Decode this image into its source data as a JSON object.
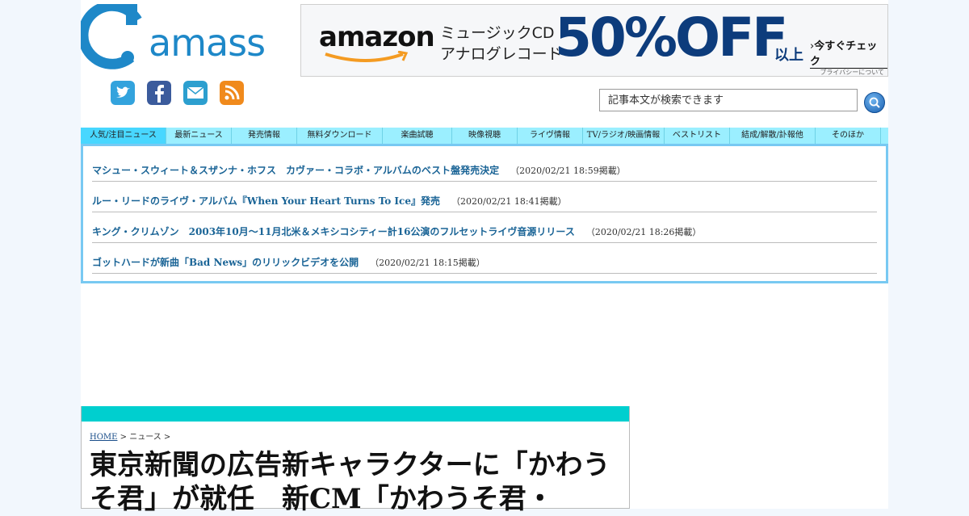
{
  "logo": {
    "text": "amass"
  },
  "social": [
    "twitter-icon",
    "facebook-icon",
    "mail-icon",
    "rss-icon"
  ],
  "ad": {
    "brand": "amazon",
    "line1": "ミュージックCD",
    "line2": "アナログレコード",
    "discount": "50%OFF",
    "suffix": "以上",
    "cta": "今すぐチェック",
    "privacy": "プライバシーについて"
  },
  "search": {
    "placeholder": "記事本文が検索できます"
  },
  "nav": [
    {
      "label": "人気/注目ニュース",
      "active": true
    },
    {
      "label": "最新ニュース"
    },
    {
      "label": "発売情報"
    },
    {
      "label": "無料ダウンロード"
    },
    {
      "label": "楽曲試聴"
    },
    {
      "label": "映像視聴"
    },
    {
      "label": "ライヴ情報"
    },
    {
      "label": "TV/ラジオ/映画情報"
    },
    {
      "label": "ベストリスト"
    },
    {
      "label": "結成/解散/訃報他"
    },
    {
      "label": "そのほか"
    }
  ],
  "news": [
    {
      "title": "マシュー・スウィート＆スザンナ・ホフス　カヴァー・コラボ・アルバムのベスト盤発売決定",
      "date": "（2020/02/21 18:59掲載）"
    },
    {
      "title": "ルー・リードのライヴ・アルバム『When Your Heart Turns To Ice』発売",
      "date": "（2020/02/21 18:41掲載）"
    },
    {
      "title": "キング・クリムゾン　2003年10月〜11月北米＆メキシコシティー計16公演のフルセットライヴ音源リリース",
      "date": "（2020/02/21 18:26掲載）"
    },
    {
      "title": "ゴットハードが新曲「Bad News」のリリックビデオを公開",
      "date": "（2020/02/21 18:15掲載）"
    }
  ],
  "article": {
    "breadcrumb_home": "HOME",
    "breadcrumb_rest": " > ニュース > ",
    "headline": "東京新聞の広告新キャラクターに「かわうそ君」が就任　新CM「かわうそ君・"
  },
  "colors": {
    "nav_bg": "#9befff",
    "nav_active": "#48d7ff",
    "news_border": "#78c9f2",
    "article_bar": "#00cfcf",
    "link": "#1a6496"
  }
}
